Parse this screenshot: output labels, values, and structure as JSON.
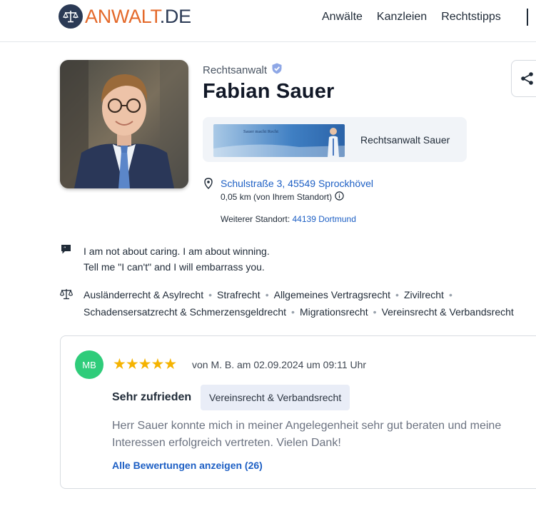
{
  "header": {
    "logo_prefix": "ANWALT",
    "logo_suffix": ".DE",
    "nav": [
      "Anwälte",
      "Kanzleien",
      "Rechtstipps"
    ]
  },
  "profile": {
    "kicker": "Rechtsanwalt",
    "name": "Fabian Sauer",
    "firm_name": "Rechtsanwalt Sauer",
    "banner_text": "Sauer macht Recht",
    "address": "Schulstraße 3, 45549 Sprockhövel",
    "distance": "0,05 km (von Ihrem Standort)",
    "other_location_label": "Weiterer Standort:",
    "other_location_link": "44139 Dortmund",
    "quote_lines": [
      "I am not about caring. I am about winning.",
      "Tell me \"I can't\" and I will embarrass you."
    ],
    "areas": [
      "Ausländerrecht & Asylrecht",
      "Strafrecht",
      "Allgemeines Vertragsrecht",
      "Zivilrecht",
      "Schadensersatzrecht & Schmerzensgeldrecht",
      "Migrationsrecht",
      "Vereinsrecht & Verbandsrecht"
    ]
  },
  "review": {
    "initials": "MB",
    "rating": 5,
    "meta": "von M. B. am 02.09.2024 um 09:11 Uhr",
    "title": "Sehr zufrieden",
    "tag": "Vereinsrecht & Verbandsrecht",
    "text": "Herr Sauer konnte mich in meiner Angelegenheit sehr gut beraten und meine Interessen erfolgreich vertreten. Vielen Dank!",
    "all_link": "Alle Bewertungen anzeigen (26)"
  },
  "colors": {
    "brand_orange": "#e4692a",
    "brand_navy": "#2b3a55",
    "link_blue": "#1d5fc4",
    "star_yellow": "#f5b301",
    "avatar_green": "#2fcc7a"
  },
  "icons": [
    "scales-logo-icon",
    "verified-badge-icon",
    "share-icon",
    "location-pin-icon",
    "info-icon",
    "quote-icon",
    "scales-icon",
    "star-icon"
  ]
}
